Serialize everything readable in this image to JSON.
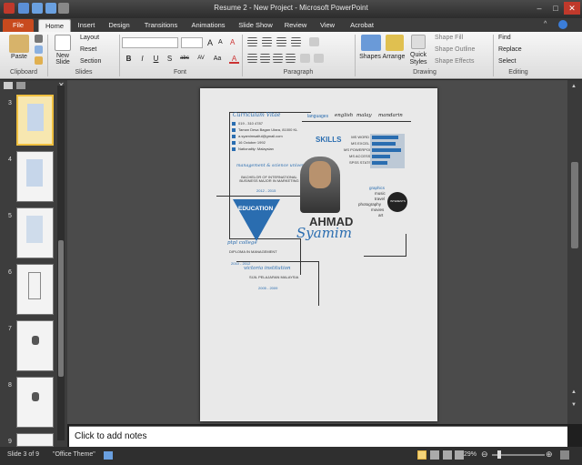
{
  "window": {
    "title": "Resume 2 - New Project  -  Microsoft PowerPoint"
  },
  "tabs": [
    "File",
    "Home",
    "Insert",
    "Design",
    "Transitions",
    "Animations",
    "Slide Show",
    "Review",
    "View",
    "Acrobat"
  ],
  "ribbon": {
    "clipboard": {
      "paste": "Paste",
      "label": "Clipboard"
    },
    "slides": {
      "new_slide": "New Slide",
      "layout": "Layout",
      "reset": "Reset",
      "section": "Section",
      "label": "Slides"
    },
    "font": {
      "label": "Font",
      "font_name": "",
      "font_size": "",
      "grow": "A",
      "shrink": "A",
      "clear": "A",
      "bold": "B",
      "italic": "I",
      "underline": "U",
      "strike": "S",
      "abc": "abc",
      "spacing": "AV",
      "case": "Aa",
      "color": "A"
    },
    "paragraph": {
      "label": "Paragraph"
    },
    "drawing": {
      "shapes": "Shapes",
      "arrange": "Arrange",
      "quick_styles": "Quick Styles",
      "shape_fill": "Shape Fill",
      "shape_outline": "Shape Outline",
      "shape_effects": "Shape Effects",
      "label": "Drawing"
    },
    "editing": {
      "find": "Find",
      "replace": "Replace",
      "select": "Select",
      "label": "Editing"
    }
  },
  "thumbnails": {
    "numbers": [
      "3",
      "4",
      "5",
      "6",
      "7",
      "8",
      "9"
    ],
    "selected": "3"
  },
  "slide": {
    "cv_title": "Curriculum Vitae",
    "phone": "019 - 310 4787",
    "address": "Taman Desa Bagan Utara, 81000 KL",
    "email": "a.syamimsaiful@gmail.com",
    "dob": "16 October 1992",
    "nationality": "Nationality: Malaysian",
    "languages_label": "languages",
    "languages": [
      "english",
      "malay",
      "mandarin"
    ],
    "skills_title": "SKILLS",
    "skills": [
      "MS WORD",
      "MS EXCEL",
      "MS POWERPOINT",
      "MS ACCESS",
      "SPSS STATS"
    ],
    "skill_levels": [
      0.85,
      0.75,
      0.95,
      0.6,
      0.5
    ],
    "uni_name": "management & science university",
    "uni_degree": "BACHELOR OF INTERNATIONAL BUSINESS MAJOR IN MARKETING",
    "uni_years": "2012 - 2015",
    "education_label": "EDUCATION",
    "college_name": "ptpl college",
    "college_course": "DIPLOMA IN MANAGEMENT",
    "college_years": "2010 - 2012",
    "school_name": "victoria institution",
    "school_cert": "SIJIL PELAJARAN MALAYSIA",
    "school_years": "2005 - 2009",
    "first_name": "AHMAD",
    "last_name": "Syamim",
    "interests": [
      "graphics",
      "music",
      "travel",
      "photography",
      "movies",
      "art"
    ],
    "interests_badge": "INTERESTS"
  },
  "notes": {
    "placeholder": "Click to add notes"
  },
  "status": {
    "slide": "Slide 3 of 9",
    "theme": "\"Office Theme\"",
    "zoom": "29%"
  },
  "colors": {
    "accent": "#2a6db0",
    "file_tab": "#c84a1e"
  }
}
